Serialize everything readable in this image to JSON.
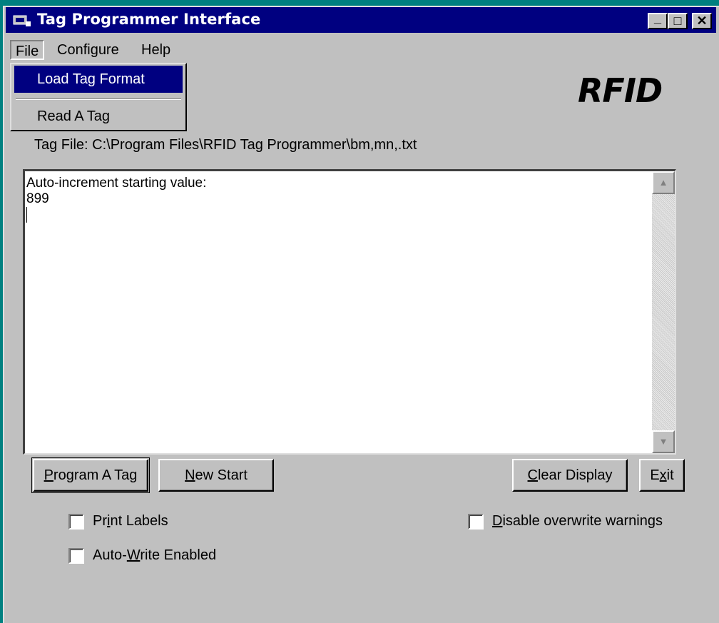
{
  "window": {
    "title": "Tag Programmer Interface",
    "controls": {
      "minimize": "_",
      "maximize": "□",
      "close": "✕"
    }
  },
  "menubar": {
    "items": [
      {
        "label": "File"
      },
      {
        "label": "Configure"
      },
      {
        "label": "Help"
      }
    ]
  },
  "file_menu": {
    "items": [
      {
        "label": "Load Tag Format",
        "highlighted": true
      },
      {
        "label": "Read A Tag",
        "highlighted": false
      }
    ]
  },
  "logo": "RFID",
  "tag_file": "Tag File: C:\\Program Files\\RFID Tag Programmer\\bm,mn,.txt",
  "display": {
    "line1": "Auto-increment starting value:",
    "line2": "899"
  },
  "buttons": {
    "program": {
      "pre": "",
      "mnemonic": "P",
      "post": "rogram A Tag"
    },
    "new_start": {
      "pre": "",
      "mnemonic": "N",
      "post": "ew Start"
    },
    "clear": {
      "pre": "",
      "mnemonic": "C",
      "post": "lear Display"
    },
    "exit": {
      "pre": "E",
      "mnemonic": "x",
      "post": "it"
    }
  },
  "checkboxes": {
    "print_labels": {
      "pre": "Pr",
      "mnemonic": "i",
      "post": "nt Labels",
      "checked": false
    },
    "auto_write": {
      "pre": "Auto-",
      "mnemonic": "W",
      "post": "rite Enabled",
      "checked": false
    },
    "disable_overwrite": {
      "pre": "",
      "mnemonic": "D",
      "post": "isable overwrite warnings",
      "checked": false
    }
  },
  "colors": {
    "titlebar": "#000080",
    "face": "#c0c0c0",
    "desktop": "#008080"
  }
}
